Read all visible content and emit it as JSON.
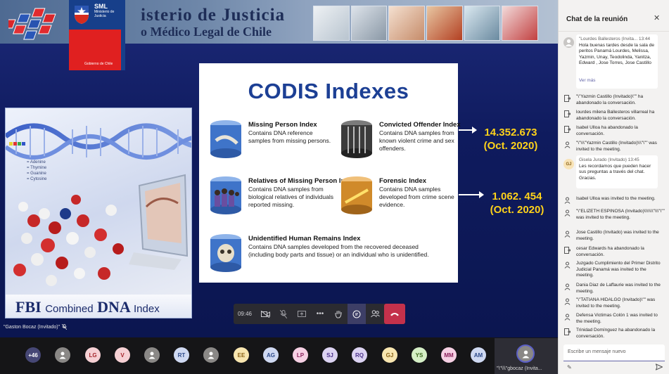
{
  "banner": {
    "title": "isterio de Justicia",
    "subtitle": "o Médico Legal de Chile",
    "sml": "SML",
    "sml_sub": "Ministerio de Justicia",
    "gobierno": "Gobierno de Chile"
  },
  "dna_panel": {
    "legend": [
      "= Adenine",
      "= Thymine",
      "= Guanine",
      "= Cytosine"
    ],
    "fbi": "FBI",
    "combined": "Combined",
    "dna": "DNA",
    "index_system": "Index System"
  },
  "slide": {
    "title": "CODIS Indexes",
    "items": [
      {
        "title": "Missing Person Index",
        "desc": "Contains DNA reference samples from missing persons."
      },
      {
        "title": "Convicted Offender Index",
        "desc": "Contains DNA samples from known violent crime and sex offenders."
      },
      {
        "title": "Relatives of Missing Person Index",
        "desc": "Contains DNA samples from biological relatives of individuals reported missing."
      },
      {
        "title": "Forensic Index",
        "desc": "Contains DNA samples developed from crime scene evidence."
      },
      {
        "title": "Unidentified Human Remains Index",
        "desc": "Contains DNA samples developed from the recovered deceased (including body parts and tissue) or an individual who is unidentified."
      }
    ]
  },
  "stats": {
    "value1": "14.352.673",
    "date1": "(Oct. 2020)",
    "value2": "1.062. 454",
    "date2": "(Oct. 2020)"
  },
  "speaker": "\"Gaston Bocaz (Invitado)\"",
  "controls": {
    "timer": "09:46"
  },
  "participants": {
    "more": "+46",
    "initials": [
      "LG",
      "V",
      "RT",
      "EE",
      "AG",
      "LP",
      "SJ",
      "RQ",
      "GJ",
      "YS",
      "MM",
      "AM"
    ],
    "self_name": "\"\\\"\\\\\\\"gbocaz (Invita..."
  },
  "chat": {
    "title": "Chat de la reunión",
    "first_msg": {
      "sender": "\"Lourdes Ballesteros (Invita...",
      "time": "13:44",
      "text": "Hola buenas tardes desde la sala de peritos Panamá Lourdes, Melissa, Yazmin, Unay, Teodolinda, Yanitza, Edward , Jose Torres, Jose Castillo",
      "more": "Ver más"
    },
    "events_a": [
      "\"\\\"Yazmin Castillo (Invitado)\\\"\" ha abandonado la conversación.",
      "lourdes milena Ballesteros villarreal ha abandonado la conversación.",
      "Isabel Ulloa ha abandonado la conversación.",
      "\"\\\"\\\\\\\"Yazmin Castillo (Invitado)\\\\\\\"\\\"\" was invited to the meeting."
    ],
    "gj_msg": {
      "sender": "Gisela Jurado (Invitado)",
      "time": "13:45",
      "initials": "GJ",
      "text": "Les recordamos que pueden hacer sus preguntas a través del chat. Gracias."
    },
    "events_b": [
      "Isabel Ulloa was invited to the meeting.",
      "\"\\\"ELIZETH ESPINOSA (Invitado)\\\\\\\\\\\\\\\"\\\\\\\"\\\"\" was invited to the meeting.",
      "Jose Castillo (Invitado) was invited to the meeting.",
      "cesar Edwards ha abandonado la conversación.",
      "Juzgado Cumplimiento del Primer Distrito Judicial Panamá was invited to the meeting.",
      "Dania Diaz de Laffaurie was invited to the meeting.",
      "\"\\\"TATIANA HIDALGO (Invitado)\\\"\" was invited to the meeting.",
      "Defensa Victimas Colón 1 was invited to the meeting.",
      "Trinidad Domínguez ha abandonado la conversación."
    ],
    "input_placeholder": "Escribe un mensaje nuevo"
  }
}
